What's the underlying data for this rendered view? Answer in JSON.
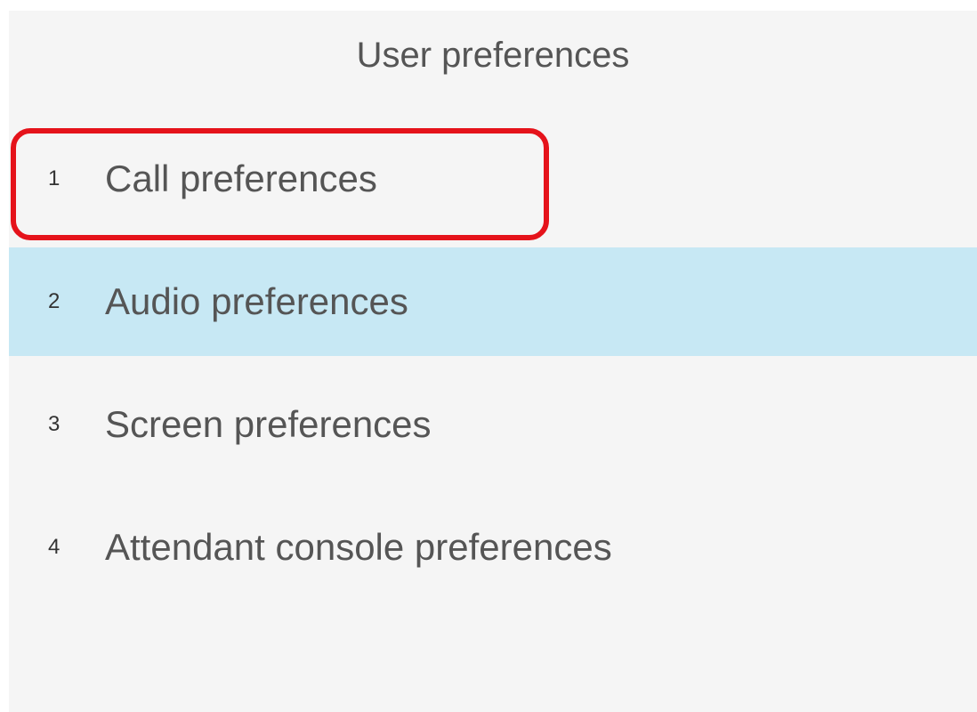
{
  "header": {
    "title": "User preferences"
  },
  "menu": {
    "items": [
      {
        "number": "1",
        "label": "Call preferences"
      },
      {
        "number": "2",
        "label": "Audio preferences",
        "selected": true
      },
      {
        "number": "3",
        "label": "Screen preferences"
      },
      {
        "number": "4",
        "label": "Attendant console preferences"
      }
    ]
  },
  "colors": {
    "background": "#f5f5f5",
    "selected_row": "#c7e8f4",
    "highlight_outline": "#e5131b",
    "text": "#555555"
  }
}
